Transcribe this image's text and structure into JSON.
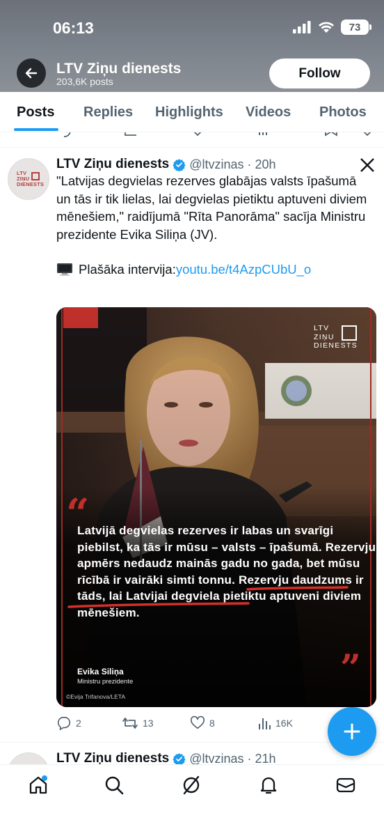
{
  "status": {
    "time": "06:13",
    "battery": "73"
  },
  "header": {
    "name": "LTV Ziņu dienests",
    "posts": "203,6K posts",
    "follow_label": "Follow"
  },
  "tabs": [
    "Posts",
    "Replies",
    "Highlights",
    "Videos",
    "Photos"
  ],
  "tweet": {
    "name": "LTV Ziņu dienests",
    "handle": "@ltvzinas",
    "time": "· 20h",
    "text": "\"Latvijas degvielas rezerves glabājas valsts īpašumā un tās ir tik lielas, lai degvielas pietiktu aptuveni diviem mēnešiem,\" raidījumā \"Rīta Panorāma\" sacīja Ministru prezidente Evika Siliņa (JV).",
    "link_prefix": "Plašāka intervija: ",
    "link": "youtu.be/t4AzpCUbU_o",
    "media": {
      "logo_lines": [
        "LTV",
        "ZIŅU",
        "DIENESTS"
      ],
      "quote": "Latvijā degvielas rezerves ir labas un svarīgi piebilst, ka tās ir mūsu – valsts – īpašumā. Rezervju apmērs nedaudz mainās gadu no gada, bet mūsu rīcībā ir vairāki simti tonnu. Rezervju daudzums ir tāds, lai Latvijai degviela pietiktu aptuveni diviem mēnešiem.",
      "speaker": "Evika Siliņa",
      "speaker_role": "Ministru prezidente",
      "credit": "©Evija Trifanova/LETA"
    },
    "stats": {
      "replies": "2",
      "reposts": "13",
      "likes": "8",
      "views": "16K"
    }
  },
  "next_tweet": {
    "name": "LTV Ziņu dienests",
    "handle": "@ltvzinas",
    "time": "· 21h"
  },
  "avatar_logo": [
    "LTV",
    "ZIŅU",
    "DIENESTS"
  ],
  "colors": {
    "accent": "#1d9bf0",
    "brand_red": "#b2413d"
  },
  "icons": [
    "back-arrow-icon",
    "verified-badge-icon",
    "x-logo-icon",
    "reply-icon",
    "repost-icon",
    "like-icon",
    "views-icon",
    "plus-icon",
    "home-icon",
    "search-icon",
    "grok-icon",
    "notifications-icon",
    "messages-icon"
  ]
}
